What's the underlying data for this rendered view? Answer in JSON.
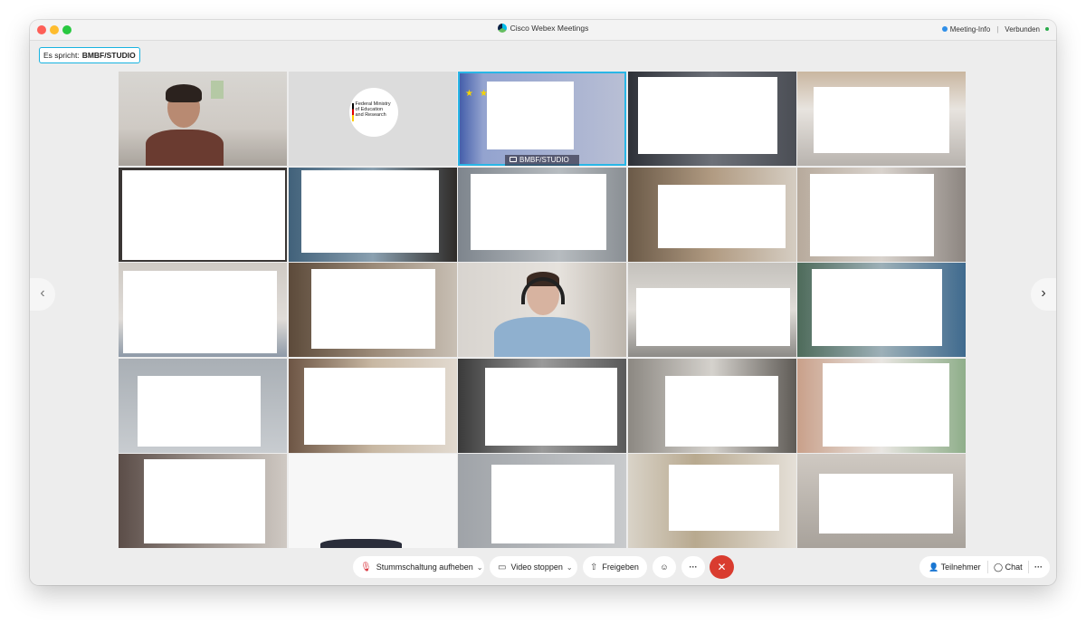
{
  "window": {
    "title": "Cisco Webex Meetings",
    "meeting_info": "Meeting-Info",
    "connection_status": "Verbunden"
  },
  "speaker": {
    "label": "Es spricht:",
    "name": "BMBF/STUDIO"
  },
  "logo": {
    "line1": "Federal Ministry",
    "line2": "of Education",
    "line3": "and Research"
  },
  "active_tile_name": "BMBF/STUDIO",
  "nav": {
    "prev_icon": "‹",
    "next_icon": "›"
  },
  "toolbar": {
    "mute_label": "Stummschaltung aufheben",
    "video_label": "Video stoppen",
    "share_label": "Freigeben",
    "emoji_icon": "☺",
    "more_icon": "···",
    "end_icon": "✕"
  },
  "right_panel": {
    "participants_label": "Teilnehmer",
    "chat_label": "Chat",
    "more_icon": "···"
  },
  "colors": {
    "accent": "#29b6e6",
    "end_call": "#d93c2f",
    "connected": "#2aab4a"
  }
}
